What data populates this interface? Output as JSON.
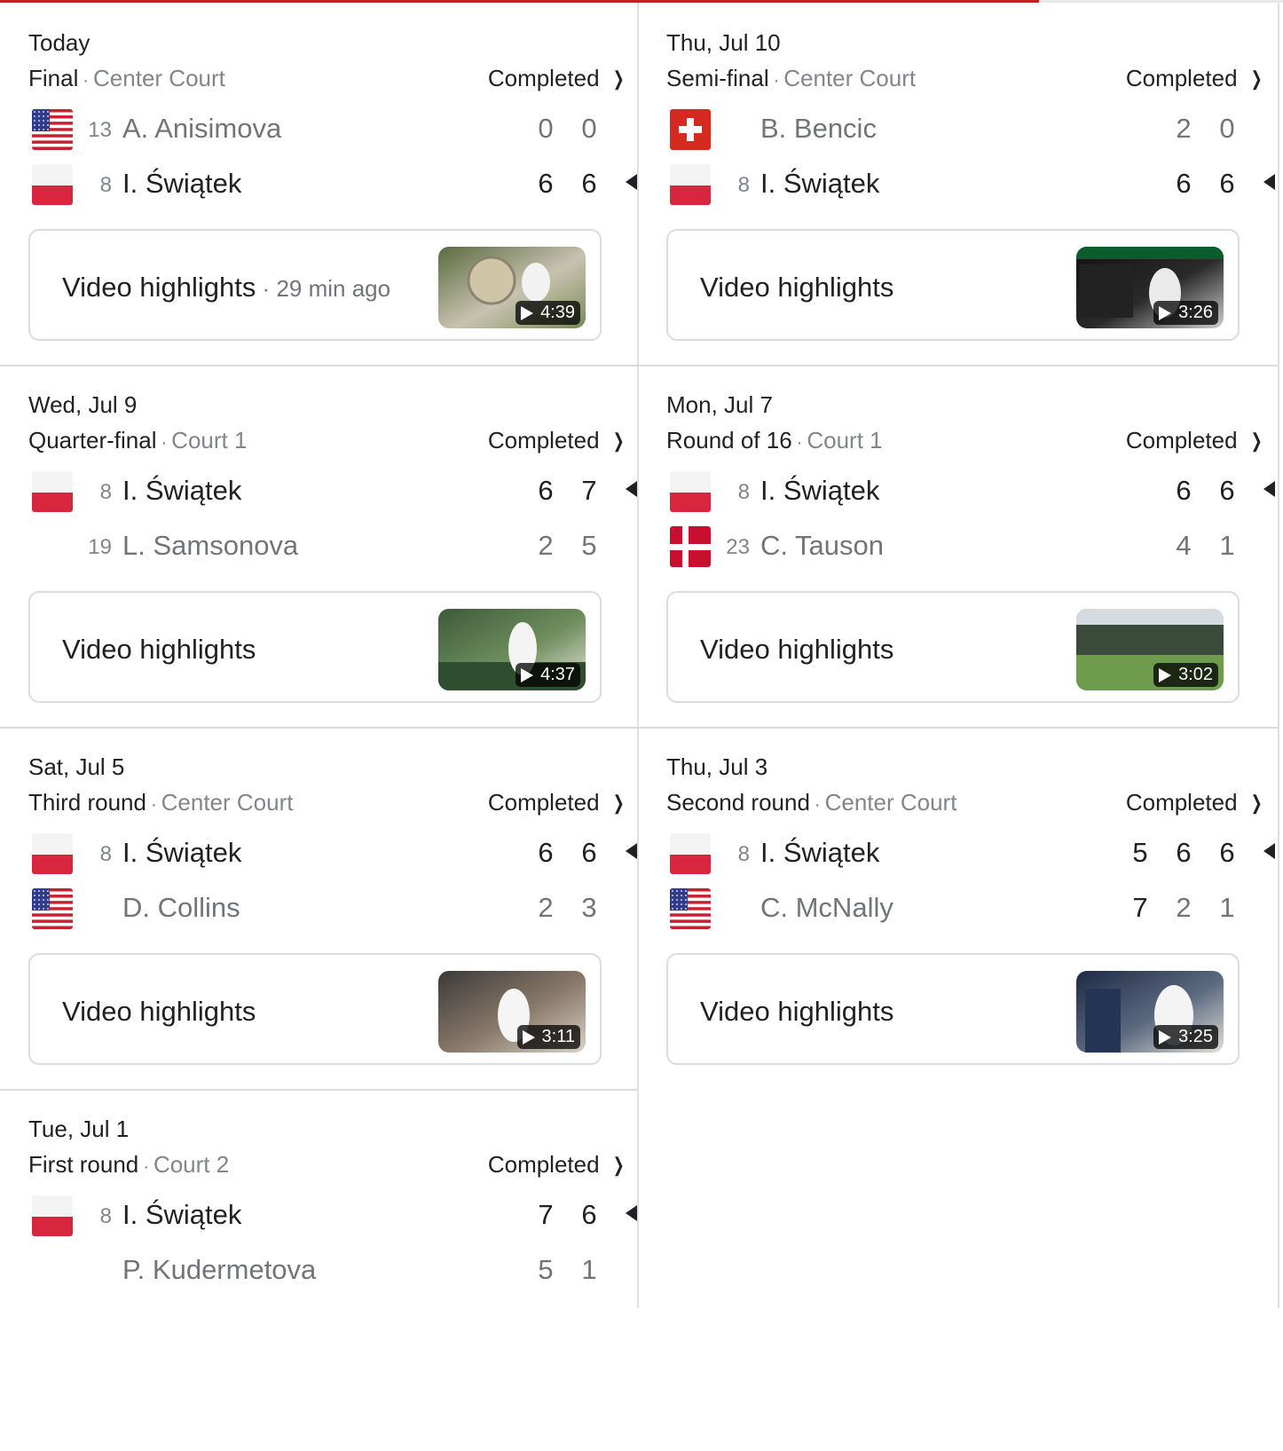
{
  "progress": 0.81,
  "colors": {
    "accent": "#c5221f",
    "divider": "#dadce0"
  },
  "matches": [
    {
      "date": "Today",
      "round": "Final",
      "court": "Center Court",
      "status": "Completed",
      "players": [
        {
          "flag": "usa",
          "seed": "13",
          "name": "A. Anisimova",
          "scores": [
            "0",
            "0"
          ],
          "winner": false
        },
        {
          "flag": "poland",
          "seed": "8",
          "name": "I. Świątek",
          "scores": [
            "6",
            "6"
          ],
          "winner": true
        }
      ],
      "video": {
        "label": "Video highlights",
        "age": "29 min ago",
        "duration": "4:39",
        "thumb": "trophy"
      }
    },
    {
      "date": "Thu, Jul 10",
      "round": "Semi-final",
      "court": "Center Court",
      "status": "Completed",
      "players": [
        {
          "flag": "switzerland",
          "seed": "",
          "name": "B. Bencic",
          "scores": [
            "2",
            "0"
          ],
          "winner": false
        },
        {
          "flag": "poland",
          "seed": "8",
          "name": "I. Świątek",
          "scores": [
            "6",
            "6"
          ],
          "winner": true
        }
      ],
      "video": {
        "label": "Video highlights",
        "age": "",
        "duration": "3:26",
        "thumb": "scoreboard"
      }
    },
    {
      "date": "Wed, Jul 9",
      "round": "Quarter-final",
      "court": "Court 1",
      "status": "Completed",
      "players": [
        {
          "flag": "poland",
          "seed": "8",
          "name": "I. Świątek",
          "scores": [
            "6",
            "7"
          ],
          "winner": true
        },
        {
          "flag": "none",
          "seed": "19",
          "name": "L. Samsonova",
          "scores": [
            "2",
            "5"
          ],
          "winner": false
        }
      ],
      "video": {
        "label": "Video highlights",
        "age": "",
        "duration": "4:37",
        "thumb": "court"
      }
    },
    {
      "date": "Mon, Jul 7",
      "round": "Round of 16",
      "court": "Court 1",
      "status": "Completed",
      "players": [
        {
          "flag": "poland",
          "seed": "8",
          "name": "I. Świątek",
          "scores": [
            "6",
            "6"
          ],
          "winner": true
        },
        {
          "flag": "denmark",
          "seed": "23",
          "name": "C. Tauson",
          "scores": [
            "4",
            "1"
          ],
          "winner": false
        }
      ],
      "video": {
        "label": "Video highlights",
        "age": "",
        "duration": "3:02",
        "thumb": "stadium"
      }
    },
    {
      "date": "Sat, Jul 5",
      "round": "Third round",
      "court": "Center Court",
      "status": "Completed",
      "players": [
        {
          "flag": "poland",
          "seed": "8",
          "name": "I. Świątek",
          "scores": [
            "6",
            "6"
          ],
          "winner": true
        },
        {
          "flag": "usa",
          "seed": "",
          "name": "D. Collins",
          "scores": [
            "2",
            "3"
          ],
          "winner": false
        }
      ],
      "video": {
        "label": "Video highlights",
        "age": "",
        "duration": "3:11",
        "thumb": "crowd"
      }
    },
    {
      "date": "Thu, Jul 3",
      "round": "Second round",
      "court": "Center Court",
      "status": "Completed",
      "players": [
        {
          "flag": "poland",
          "seed": "8",
          "name": "I. Świątek",
          "scores": [
            "5",
            "6",
            "6"
          ],
          "winner": true,
          "set_winners": [
            false,
            true,
            true
          ]
        },
        {
          "flag": "usa",
          "seed": "",
          "name": "C. McNally",
          "scores": [
            "7",
            "2",
            "1"
          ],
          "winner": false,
          "set_winners": [
            true,
            false,
            false
          ]
        }
      ],
      "video": {
        "label": "Video highlights",
        "age": "",
        "duration": "3:25",
        "thumb": "handshake"
      }
    },
    {
      "date": "Tue, Jul 1",
      "round": "First round",
      "court": "Court 2",
      "status": "Completed",
      "players": [
        {
          "flag": "poland",
          "seed": "8",
          "name": "I. Świątek",
          "scores": [
            "7",
            "6"
          ],
          "winner": true
        },
        {
          "flag": "none",
          "seed": "",
          "name": "P. Kudermetova",
          "scores": [
            "5",
            "1"
          ],
          "winner": false
        }
      ],
      "video": null
    }
  ]
}
